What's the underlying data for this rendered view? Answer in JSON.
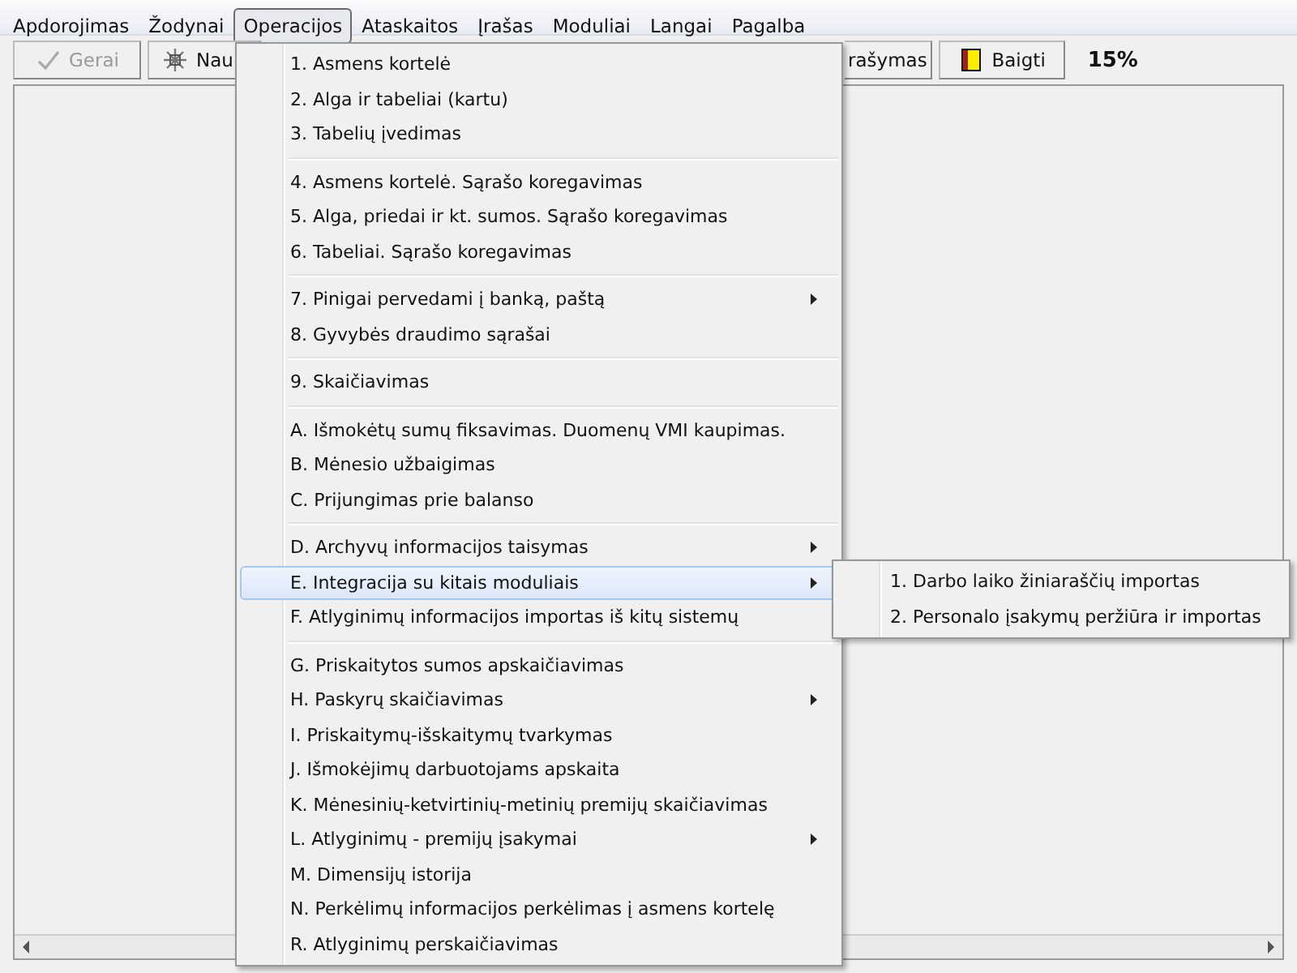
{
  "menubar": [
    {
      "label": "Apdorojimas",
      "selected": false
    },
    {
      "label": "Žodynai",
      "selected": false
    },
    {
      "label": "Operacijos",
      "selected": true
    },
    {
      "label": "Ataskaitos",
      "selected": false
    },
    {
      "label": "Įrašas",
      "selected": false
    },
    {
      "label": "Moduliai",
      "selected": false
    },
    {
      "label": "Langai",
      "selected": false
    },
    {
      "label": "Pagalba",
      "selected": false
    }
  ],
  "toolbar": {
    "buttons": [
      {
        "label": "Gerai",
        "kind": "check",
        "disabled": true
      },
      {
        "label": "Nau",
        "kind": "new",
        "disabled": false
      },
      {
        "label": "rašymas",
        "kind": "plain",
        "disabled": false
      },
      {
        "label": "Baigti",
        "kind": "door",
        "disabled": false
      }
    ],
    "progress": "15%"
  },
  "menu": {
    "groups": [
      [
        {
          "label": "1. Asmens kortelė",
          "submenu": false,
          "selected": false
        },
        {
          "label": "2. Alga ir tabeliai (kartu)",
          "submenu": false,
          "selected": false
        },
        {
          "label": "3. Tabelių įvedimas",
          "submenu": false,
          "selected": false
        }
      ],
      [
        {
          "label": "4. Asmens kortelė. Sąrašo koregavimas",
          "submenu": false,
          "selected": false
        },
        {
          "label": "5. Alga, priedai ir kt. sumos. Sąrašo koregavimas",
          "submenu": false,
          "selected": false
        },
        {
          "label": "6. Tabeliai. Sąrašo koregavimas",
          "submenu": false,
          "selected": false
        }
      ],
      [
        {
          "label": "7. Pinigai pervedami į banką, paštą",
          "submenu": true,
          "selected": false
        },
        {
          "label": "8. Gyvybės draudimo sąrašai",
          "submenu": false,
          "selected": false
        }
      ],
      [
        {
          "label": "9. Skaičiavimas",
          "submenu": false,
          "selected": false
        }
      ],
      [
        {
          "label": "A. Išmokėtų sumų fiksavimas. Duomenų VMI kaupimas.",
          "submenu": false,
          "selected": false
        },
        {
          "label": "B. Mėnesio užbaigimas",
          "submenu": false,
          "selected": false
        },
        {
          "label": "C. Prijungimas prie balanso",
          "submenu": false,
          "selected": false
        }
      ],
      [
        {
          "label": "D. Archyvų informacijos taisymas",
          "submenu": true,
          "selected": false
        },
        {
          "label": "E. Integracija su kitais moduliais",
          "submenu": true,
          "selected": true,
          "children": [
            {
              "label": "1. Darbo laiko žiniaraščių importas"
            },
            {
              "label": "2. Personalo įsakymų peržiūra ir importas"
            }
          ]
        },
        {
          "label": "F. Atlyginimų informacijos importas iš kitų sistemų",
          "submenu": false,
          "selected": false
        }
      ],
      [
        {
          "label": "G. Priskaitytos sumos apskaičiavimas",
          "submenu": false,
          "selected": false
        },
        {
          "label": "H. Paskyrų skaičiavimas",
          "submenu": true,
          "selected": false
        },
        {
          "label": "I. Priskaitymų-išskaitymų  tvarkymas",
          "submenu": false,
          "selected": false
        },
        {
          "label": "J. Išmokėjimų darbuotojams apskaita",
          "submenu": false,
          "selected": false
        },
        {
          "label": "K. Mėnesinių-ketvirtinių-metinių premijų skaičiavimas",
          "submenu": false,
          "selected": false
        },
        {
          "label": "L. Atlyginimų - premijų įsakymai",
          "submenu": true,
          "selected": false
        },
        {
          "label": "M. Dimensijų istorija",
          "submenu": false,
          "selected": false
        },
        {
          "label": "N. Perkėlimų informacijos perkėlimas į asmens kortelę",
          "submenu": false,
          "selected": false
        },
        {
          "label": "R. Atlyginimų perskaičiavimas",
          "submenu": false,
          "selected": false
        }
      ]
    ]
  }
}
